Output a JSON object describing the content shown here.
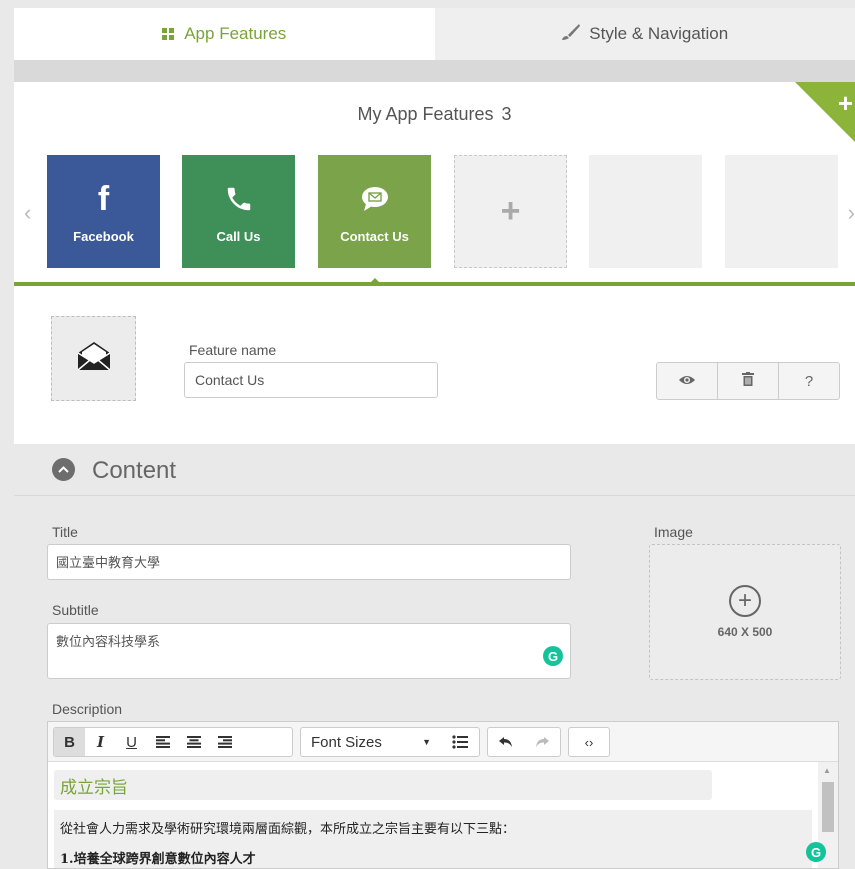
{
  "tabs": {
    "app_features": "App Features",
    "style_navigation": "Style & Navigation"
  },
  "features": {
    "title": "My App Features",
    "count": "3",
    "tiles": [
      {
        "label": "Facebook",
        "icon": "facebook-icon",
        "color": "#3b5998"
      },
      {
        "label": "Call Us",
        "icon": "phone-icon",
        "color": "#3e8f58"
      },
      {
        "label": "Contact Us",
        "icon": "chat-icon",
        "color": "#7aa34a"
      }
    ]
  },
  "detail": {
    "feature_name_label": "Feature name",
    "feature_name_value": "Contact Us",
    "buttons": {
      "view": "eye-icon",
      "delete": "trash-icon",
      "help": "?"
    }
  },
  "content": {
    "heading": "Content",
    "title_label": "Title",
    "title_value": "國立臺中教育大學",
    "subtitle_label": "Subtitle",
    "subtitle_value": "數位內容科技學系",
    "image_label": "Image",
    "image_size": "640 X 500",
    "description_label": "Description",
    "toolbar": {
      "bold": "B",
      "italic": "I",
      "underline": "U",
      "font_sizes": "Font Sizes"
    },
    "description": {
      "heading": "成立宗旨",
      "line1": "從社會人力需求及學術研究環境兩層面綜觀，本所成立之宗旨主要有以下三點：",
      "line2": "1.培養全球跨界創意數位內容人才"
    }
  },
  "colors": {
    "accent": "#7aa33a",
    "facebook": "#3b5998",
    "call": "#3e8f58",
    "contact": "#7aa34a",
    "grammarly": "#15c39a"
  }
}
